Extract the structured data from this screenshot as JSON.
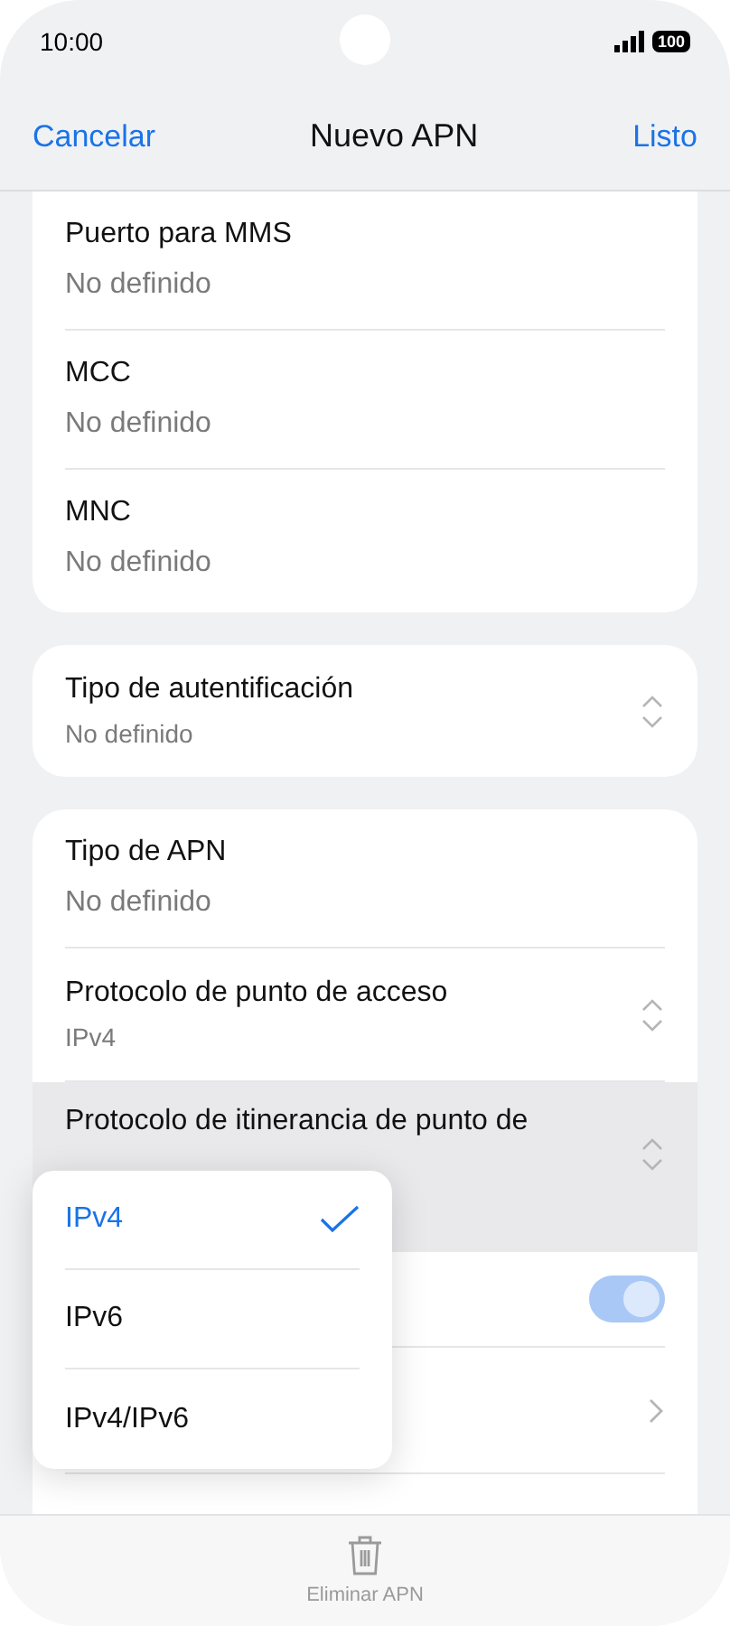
{
  "status_bar": {
    "time": "10:00",
    "battery": "100"
  },
  "header": {
    "cancel": "Cancelar",
    "title": "Nuevo APN",
    "done": "Listo"
  },
  "sections": [
    {
      "rows": [
        {
          "kind": "text",
          "title": "Puerto para MMS",
          "value": "No definido"
        },
        {
          "kind": "text",
          "title": "MCC",
          "value": "No definido"
        },
        {
          "kind": "text",
          "title": "MNC",
          "value": "No definido"
        }
      ]
    },
    {
      "rows": [
        {
          "kind": "select",
          "title": "Tipo de autentificación",
          "value": "No definido"
        }
      ]
    },
    {
      "rows": [
        {
          "kind": "text",
          "title": "Tipo de APN",
          "value": "No definido"
        },
        {
          "kind": "select",
          "title": "Protocolo de punto de acceso",
          "value": "IPv4"
        },
        {
          "kind": "select",
          "title": "Protocolo de itinerancia de punto de",
          "pressed": true
        },
        {
          "kind": "toggle",
          "on": true
        },
        {
          "kind": "link"
        },
        {
          "kind": "text"
        }
      ]
    }
  ],
  "popup": {
    "options": [
      {
        "label": "IPv4",
        "selected": true
      },
      {
        "label": "IPv6",
        "selected": false
      },
      {
        "label": "IPv4/IPv6",
        "selected": false
      }
    ]
  },
  "bottom_bar": {
    "label": "Eliminar APN"
  }
}
